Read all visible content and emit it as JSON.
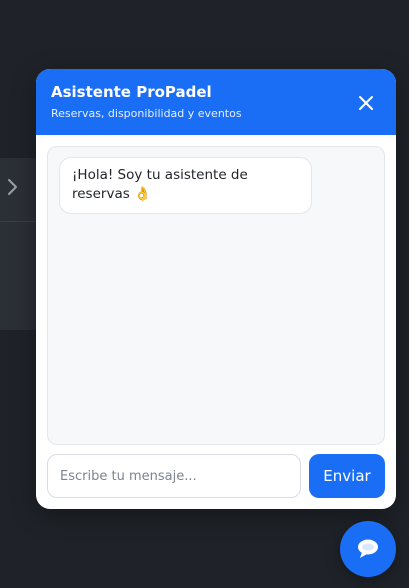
{
  "chat": {
    "title": "Asistente ProPadel",
    "subtitle": "Reservas, disponibilidad y eventos",
    "messages": [
      {
        "from": "bot",
        "text": "¡Hola! Soy tu asistente de reservas 👌"
      }
    ],
    "input": {
      "placeholder": "Escribe tu mensaje...",
      "value": ""
    },
    "send_label": "Enviar"
  },
  "icons": {
    "close": "close-icon",
    "fab": "chat-bubble-icon",
    "background_chevron": "chevron-right-icon"
  },
  "colors": {
    "accent": "#1a6ef5",
    "page_background": "#1f2329",
    "messages_background": "#f7f8fa"
  }
}
